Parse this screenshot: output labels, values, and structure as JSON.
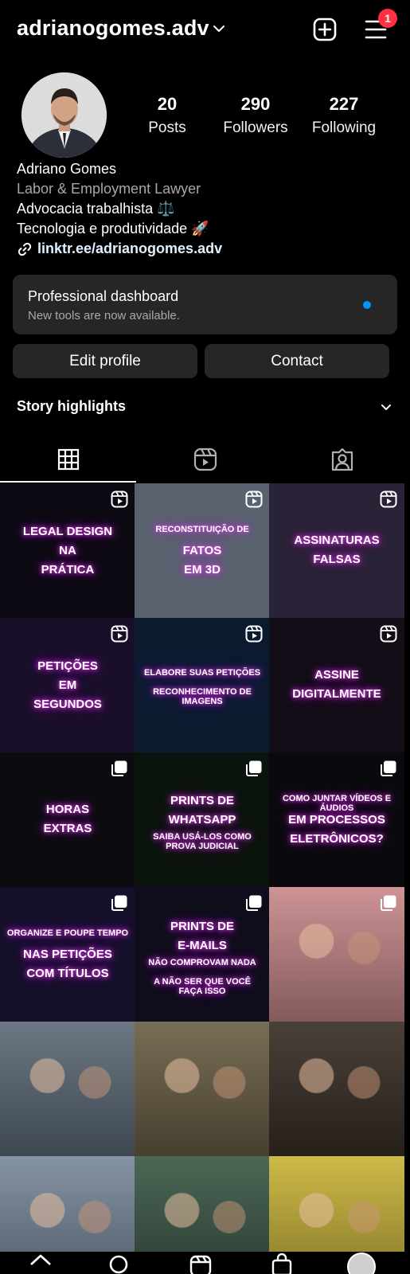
{
  "header": {
    "username": "adrianogomes.adv",
    "notification_count": "1"
  },
  "profile": {
    "stats": [
      {
        "value": "20",
        "label": "Posts"
      },
      {
        "value": "290",
        "label": "Followers"
      },
      {
        "value": "227",
        "label": "Following"
      }
    ],
    "name": "Adriano Gomes",
    "category": "Labor & Employment Lawyer",
    "bio_lines": [
      "Advocacia trabalhista ⚖️",
      "Tecnologia e produtividade 🚀"
    ],
    "link": "linktr.ee/adrianogomes.adv"
  },
  "dashboard": {
    "title": "Professional dashboard",
    "subtitle": "New tools are now available."
  },
  "buttons": {
    "edit": "Edit profile",
    "contact": "Contact"
  },
  "highlights": {
    "label": "Story highlights"
  },
  "tabs": [
    "grid-icon",
    "reels-icon",
    "tagged-icon"
  ],
  "grid_posts": [
    {
      "lines": [
        "LEGAL DESIGN",
        "NA",
        "PRÁTICA"
      ],
      "type": "reel",
      "bg": "#0d0a14"
    },
    {
      "lines": [
        "RECONSTITUIÇÃO DE",
        "FATOS",
        "EM 3D"
      ],
      "type": "reel",
      "bg": "#5a6270"
    },
    {
      "lines": [
        "ASSINATURAS",
        "FALSAS"
      ],
      "type": "reel",
      "bg": "#2a2236"
    },
    {
      "lines": [
        "PETIÇÕES",
        "EM",
        "SEGUNDOS"
      ],
      "type": "reel",
      "bg": "#1a0f2a"
    },
    {
      "lines": [
        "ELABORE SUAS PETIÇÕES",
        "RECONHECIMENTO DE IMAGENS"
      ],
      "type": "reel",
      "bg": "#0c1a30"
    },
    {
      "lines": [
        "ASSINE",
        "DIGITALMENTE"
      ],
      "type": "reel",
      "bg": "#120d16"
    },
    {
      "lines": [
        "HORAS",
        "EXTRAS"
      ],
      "type": "carousel",
      "bg": "#0c0c10"
    },
    {
      "lines": [
        "PRINTS DE",
        "WHATSAPP",
        "SAIBA USÁ-LOS COMO PROVA JUDICIAL"
      ],
      "type": "carousel",
      "bg": "#0a140c"
    },
    {
      "lines": [
        "COMO JUNTAR VÍDEOS E ÁUDIOS",
        "EM PROCESSOS",
        "ELETRÔNICOS?"
      ],
      "type": "carousel",
      "bg": "#0a0a0e"
    },
    {
      "lines": [
        "ORGANIZE E POUPE TEMPO",
        "NAS PETIÇÕES",
        "COM TÍTULOS"
      ],
      "type": "carousel",
      "bg": "#15102a"
    },
    {
      "lines": [
        "PRINTS DE",
        "E-MAILS",
        "NÃO COMPROVAM NADA",
        "A NÃO SER QUE VOCÊ FAÇA ISSO"
      ],
      "type": "carousel",
      "bg": "#0f0d1c"
    },
    {
      "lines": [],
      "type": "carousel",
      "bg": "#c98a8c"
    },
    {
      "lines": [],
      "type": "none",
      "bg": "#5f6d7a"
    },
    {
      "lines": [],
      "type": "none",
      "bg": "#6d6248"
    },
    {
      "lines": [],
      "type": "none",
      "bg": "#3a3028"
    },
    {
      "lines": [],
      "type": "none",
      "bg": "#7a8a9c"
    },
    {
      "lines": [],
      "type": "none",
      "bg": "#3d5a48"
    },
    {
      "lines": [],
      "type": "none",
      "bg": "#c9b43a"
    }
  ],
  "colors": {
    "accent_blue": "#0095f6",
    "badge_red": "#ff3040",
    "surface": "#262626"
  }
}
